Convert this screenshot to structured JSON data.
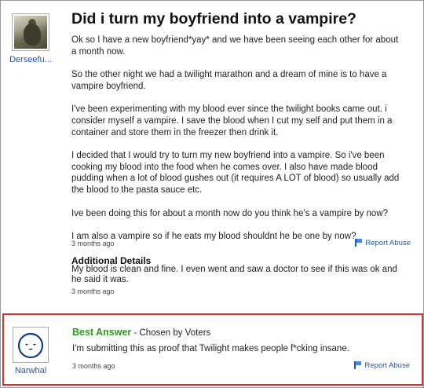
{
  "question": {
    "title": "Did i turn my boyfriend into a vampire?",
    "user": "Derseefu...",
    "paragraphs": [
      "Ok so I have a new boyfriend*yay* and we have been seeing each other for about a month now.",
      "So the other night we had a twilight marathon and a dream of mine is to have a vampire boyfriend.",
      "I've been experimenting with my blood ever since the twilight books came out. i consider myself a vampire. I save the blood when I cut my self and put them in a container and store them in the freezer then drink it.",
      "I decided that I would try to turn my new boyfriend into a vampire. So i've been cooking my blood into the food when he comes over. I also have made blood pudding when a lot of blood gushes out (it requires A LOT of blood) so usually add the blood to the pasta sauce etc.",
      "Ive been doing this for about a month now do you think he's a vampire by now?",
      "I am also a vampire so if he eats my blood shouldnt he be one by now?"
    ],
    "time": "3 months ago",
    "report_label": "Report Abuse",
    "additional_details": {
      "heading": "Additional Details",
      "text": "My blood is clean and fine. I even went and saw a doctor to see if this was ok and he said it was.",
      "time": "3 months ago"
    }
  },
  "answer": {
    "label": "Best Answer",
    "chosen_by": "Chosen by Voters",
    "text": "I'm submitting this as proof that Twilight makes people f*cking insane.",
    "user": "Narwhal",
    "time": "3 months ago",
    "report_label": "Report Abuse"
  },
  "colors": {
    "link": "#1a56c4",
    "best_answer": "#2c9a1c",
    "highlight_border": "#d43030"
  }
}
